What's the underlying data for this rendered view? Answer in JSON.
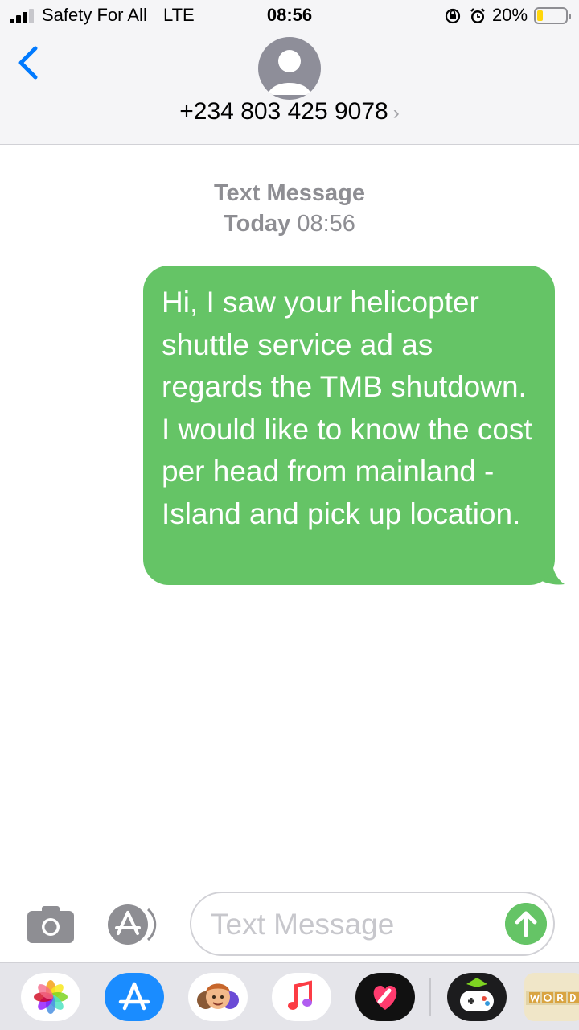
{
  "status_bar": {
    "carrier": "Safety For All",
    "network": "LTE",
    "time": "08:56",
    "battery_percent": "20%",
    "battery_level": 0.2,
    "battery_color": "#ffd60a"
  },
  "header": {
    "back_icon": "chevron-left-icon",
    "avatar_icon": "person-icon",
    "contact_name": "+234 803 425 9078",
    "chevron": "›"
  },
  "conversation": {
    "service_label": "Text Message",
    "day": "Today",
    "time": "08:56",
    "messages": [
      {
        "direction": "outgoing",
        "text": "Hi, I saw your helicopter shuttle service ad as regards the TMB shutdown. I would like to know the cost per head from mainland - Island and pick up location.",
        "color": "#65c466"
      }
    ]
  },
  "input_bar": {
    "camera_icon": "camera-icon",
    "apps_icon": "app-store-icon",
    "placeholder": "Text Message",
    "send_icon": "send-arrow-icon"
  },
  "app_drawer": {
    "apps": [
      "photos-icon",
      "app-store-icon",
      "memoji-icon",
      "music-icon",
      "digital-touch-icon",
      "game-icon",
      "word-game-icon"
    ]
  },
  "colors": {
    "accent": "#007aff",
    "imessage_green": "#65c466",
    "header_bg": "#f5f5f7"
  }
}
